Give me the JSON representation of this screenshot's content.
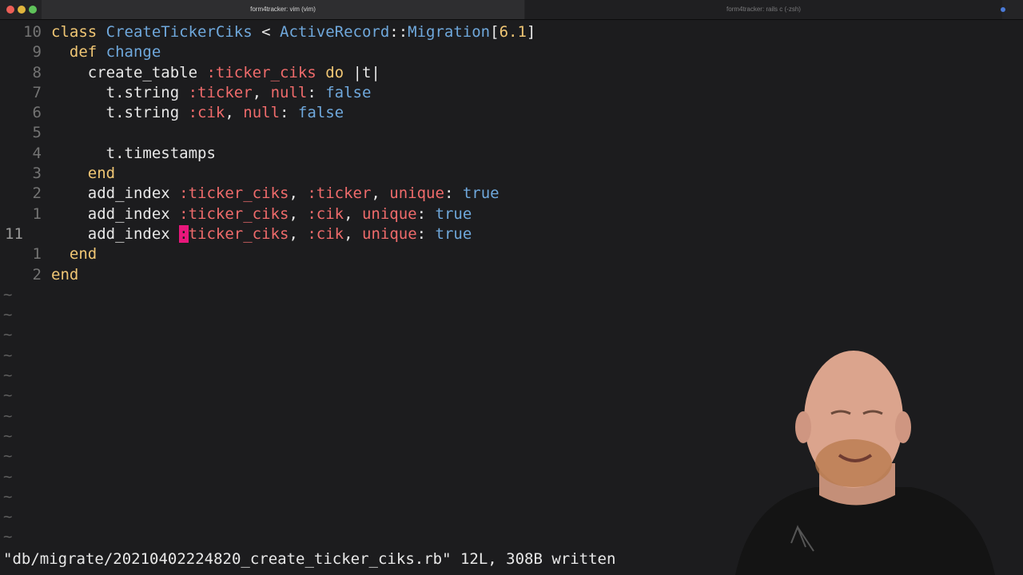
{
  "window": {
    "tabs": [
      {
        "title": "form4tracker: vim (vim)",
        "active": true
      },
      {
        "title": "form4tracker: rails c (-zsh)",
        "active": false
      }
    ],
    "colors": {
      "close": "#ec5f57",
      "minimize": "#e0b53d",
      "zoom": "#5fc35a",
      "cursor": "#e8177b"
    }
  },
  "editor": {
    "lines": [
      {
        "num": "10",
        "current": false,
        "tokens": [
          {
            "t": "kw",
            "v": "class "
          },
          {
            "t": "cls",
            "v": "CreateTickerCiks"
          },
          {
            "t": "pl",
            "v": " < "
          },
          {
            "t": "cls",
            "v": "ActiveRecord"
          },
          {
            "t": "pl",
            "v": "::"
          },
          {
            "t": "cls",
            "v": "Migration"
          },
          {
            "t": "pl",
            "v": "["
          },
          {
            "t": "num",
            "v": "6.1"
          },
          {
            "t": "pl",
            "v": "]"
          }
        ]
      },
      {
        "num": "9",
        "current": false,
        "tokens": [
          {
            "t": "kw",
            "v": "  def "
          },
          {
            "t": "cls",
            "v": "change"
          }
        ]
      },
      {
        "num": "8",
        "current": false,
        "tokens": [
          {
            "t": "pl",
            "v": "    create_table "
          },
          {
            "t": "sym",
            "v": ":ticker_ciks"
          },
          {
            "t": "kw",
            "v": " do"
          },
          {
            "t": "pl",
            "v": " |t|"
          }
        ]
      },
      {
        "num": "7",
        "current": false,
        "tokens": [
          {
            "t": "pl",
            "v": "      t.string "
          },
          {
            "t": "sym",
            "v": ":ticker"
          },
          {
            "t": "pl",
            "v": ", "
          },
          {
            "t": "sym",
            "v": "null"
          },
          {
            "t": "pl",
            "v": ": "
          },
          {
            "t": "bool",
            "v": "false"
          }
        ]
      },
      {
        "num": "6",
        "current": false,
        "tokens": [
          {
            "t": "pl",
            "v": "      t.string "
          },
          {
            "t": "sym",
            "v": ":cik"
          },
          {
            "t": "pl",
            "v": ", "
          },
          {
            "t": "sym",
            "v": "null"
          },
          {
            "t": "pl",
            "v": ": "
          },
          {
            "t": "bool",
            "v": "false"
          }
        ]
      },
      {
        "num": "5",
        "current": false,
        "tokens": []
      },
      {
        "num": "4",
        "current": false,
        "tokens": [
          {
            "t": "pl",
            "v": "      t.timestamps"
          }
        ]
      },
      {
        "num": "3",
        "current": false,
        "tokens": [
          {
            "t": "kw",
            "v": "    end"
          }
        ]
      },
      {
        "num": "2",
        "current": false,
        "tokens": [
          {
            "t": "pl",
            "v": "    add_index "
          },
          {
            "t": "sym",
            "v": ":ticker_ciks"
          },
          {
            "t": "pl",
            "v": ", "
          },
          {
            "t": "sym",
            "v": ":ticker"
          },
          {
            "t": "pl",
            "v": ", "
          },
          {
            "t": "sym",
            "v": "unique"
          },
          {
            "t": "pl",
            "v": ": "
          },
          {
            "t": "bool",
            "v": "true"
          }
        ]
      },
      {
        "num": "1",
        "current": false,
        "tokens": [
          {
            "t": "pl",
            "v": "    add_index "
          },
          {
            "t": "sym",
            "v": ":ticker_ciks"
          },
          {
            "t": "pl",
            "v": ", "
          },
          {
            "t": "sym",
            "v": ":cik"
          },
          {
            "t": "pl",
            "v": ", "
          },
          {
            "t": "sym",
            "v": "unique"
          },
          {
            "t": "pl",
            "v": ": "
          },
          {
            "t": "bool",
            "v": "true"
          }
        ]
      },
      {
        "num": "11",
        "current": true,
        "tokens": [
          {
            "t": "pl",
            "v": "    add_index "
          },
          {
            "t": "cursor",
            "v": ":"
          },
          {
            "t": "sym",
            "v": "ticker_ciks"
          },
          {
            "t": "pl",
            "v": ", "
          },
          {
            "t": "sym",
            "v": ":cik"
          },
          {
            "t": "pl",
            "v": ", "
          },
          {
            "t": "sym",
            "v": "unique"
          },
          {
            "t": "pl",
            "v": ": "
          },
          {
            "t": "bool",
            "v": "true"
          }
        ]
      },
      {
        "num": "1",
        "current": false,
        "tokens": [
          {
            "t": "kw",
            "v": "  end"
          }
        ]
      },
      {
        "num": "2",
        "current": false,
        "tokens": [
          {
            "t": "kw",
            "v": "end"
          }
        ]
      }
    ],
    "tilde_count": 13,
    "tilde_char": "~"
  },
  "status_line": "\"db/migrate/20210402224820_create_ticker_ciks.rb\" 12L, 308B written"
}
